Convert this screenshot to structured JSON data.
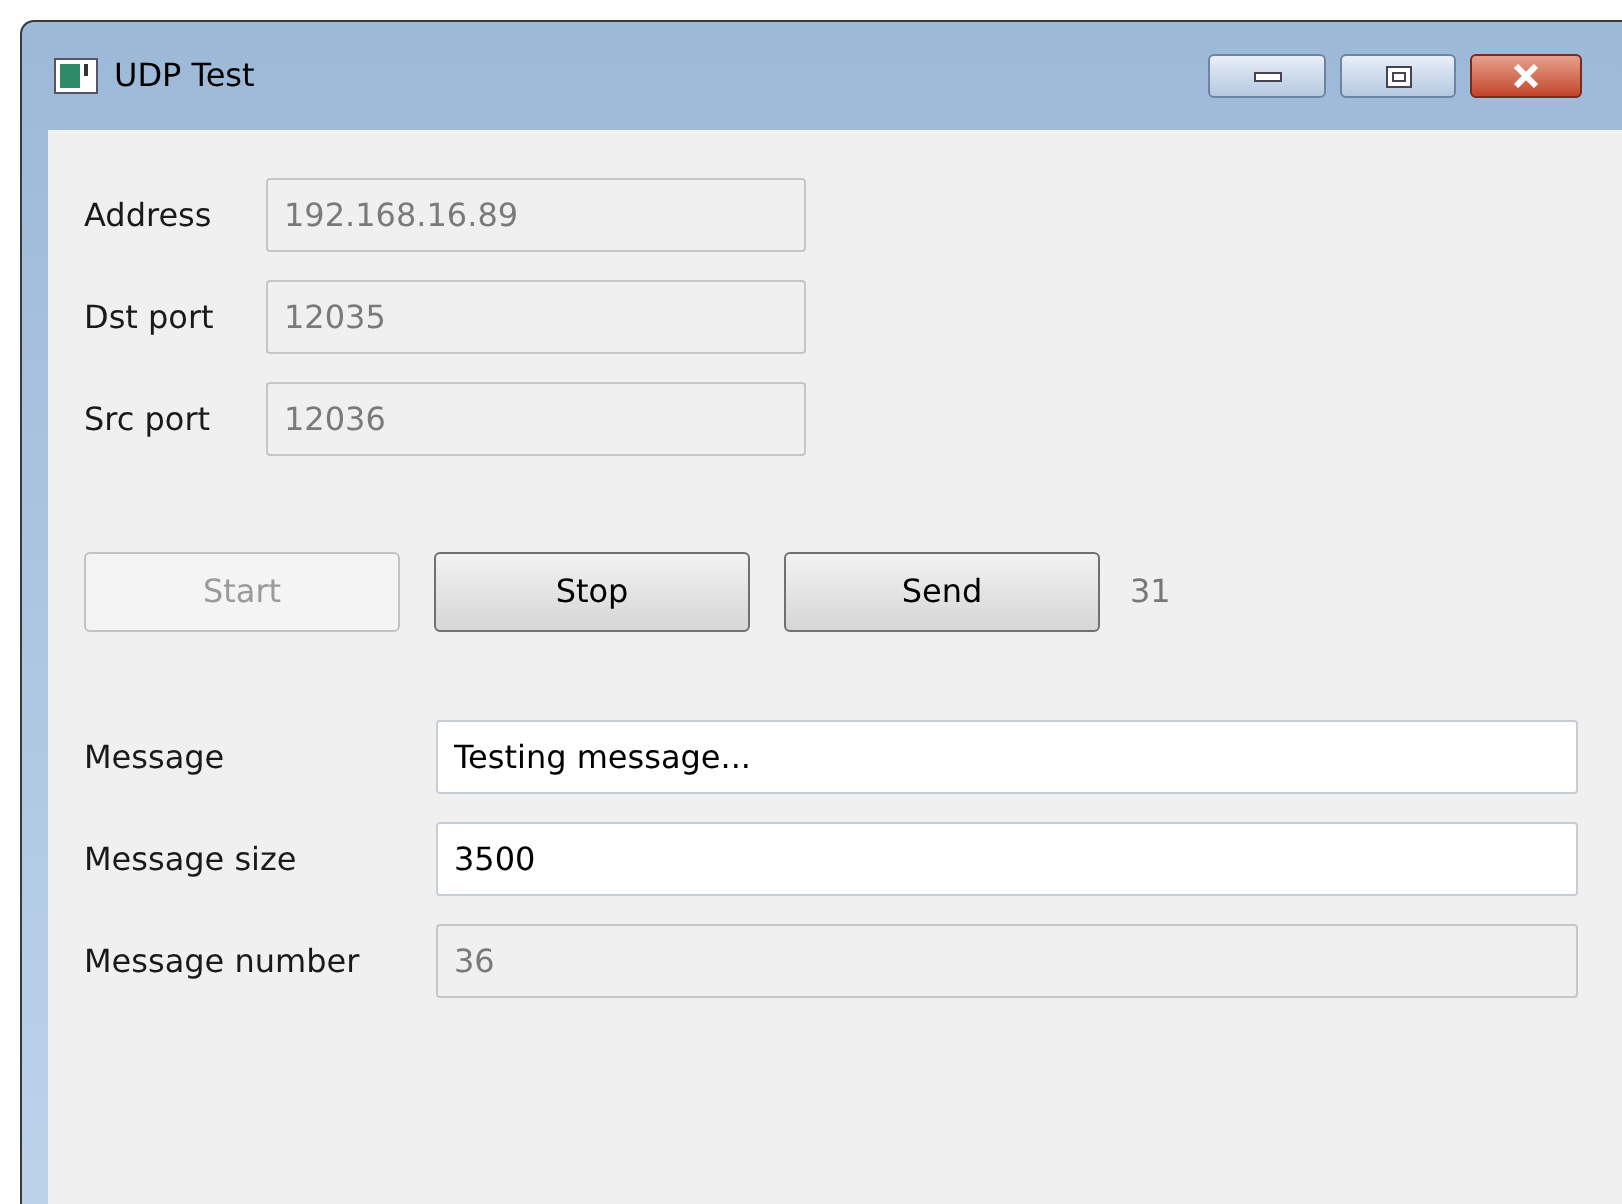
{
  "window": {
    "title": "UDP Test"
  },
  "connection_fields": [
    {
      "label": "Address",
      "value": "192.168.16.89",
      "disabled": true
    },
    {
      "label": "Dst port",
      "value": "12035",
      "disabled": true
    },
    {
      "label": "Src port",
      "value": "12036",
      "disabled": true
    }
  ],
  "buttons": [
    {
      "label": "Start",
      "disabled": true
    },
    {
      "label": "Stop",
      "disabled": false
    },
    {
      "label": "Send",
      "disabled": false
    }
  ],
  "sent_count": "31",
  "message_fields": [
    {
      "label": "Message",
      "value": "Testing message...",
      "disabled": false
    },
    {
      "label": "Message size",
      "value": "3500",
      "disabled": false
    },
    {
      "label": "Message number",
      "value": "36",
      "disabled": true
    }
  ]
}
